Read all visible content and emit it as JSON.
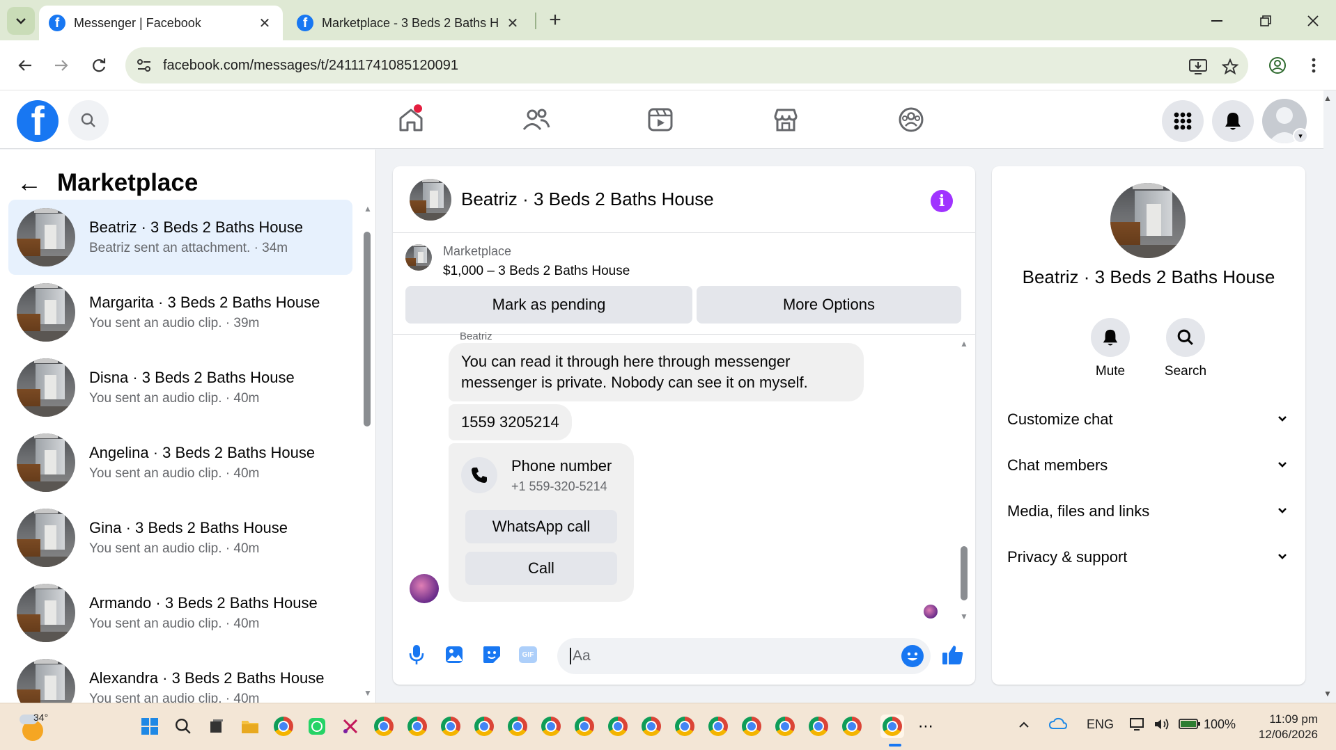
{
  "browser": {
    "tabs": [
      {
        "title": "Messenger | Facebook",
        "active": true
      },
      {
        "title": "Marketplace - 3 Beds 2 Baths H",
        "active": false
      }
    ],
    "url": "facebook.com/messages/t/24111741085120091"
  },
  "left": {
    "title": "Marketplace",
    "conversations": [
      {
        "name": "Beatriz · 3 Beds 2 Baths House",
        "sub": "Beatriz sent an attachment. · 34m"
      },
      {
        "name": "Margarita · 3 Beds 2 Baths House",
        "sub": "You sent an audio clip. · 39m"
      },
      {
        "name": "Disna · 3 Beds 2 Baths House",
        "sub": "You sent an audio clip. · 40m"
      },
      {
        "name": "Angelina · 3 Beds 2 Baths House",
        "sub": "You sent an audio clip. · 40m"
      },
      {
        "name": "Gina · 3 Beds 2 Baths House",
        "sub": "You sent an audio clip. · 40m"
      },
      {
        "name": "Armando · 3 Beds 2 Baths House",
        "sub": "You sent an audio clip. · 40m"
      },
      {
        "name": "Alexandra · 3 Beds 2 Baths House",
        "sub": "You sent an audio clip. · 40m"
      }
    ]
  },
  "chat": {
    "title": "Beatriz · 3 Beds 2 Baths House",
    "listing_kind": "Marketplace",
    "listing_price": "$1,000 – 3 Beds 2 Baths House",
    "btn_pending": "Mark as pending",
    "btn_more": "More Options",
    "sender": "Beatriz",
    "msg1": "You can read it through here through messenger messenger is private. Nobody can see it on myself.",
    "msg2": "1559 3205214",
    "contact_title": "Phone number",
    "contact_number": "+1 559-320-5214",
    "whatsapp_call": "WhatsApp call",
    "call": "Call",
    "input_placeholder": "Aa",
    "gif_label": "GIF"
  },
  "info": {
    "name": "Beatriz · 3 Beds 2 Baths House",
    "mute": "Mute",
    "search": "Search",
    "sections": [
      "Customize chat",
      "Chat members",
      "Media, files and links",
      "Privacy & support"
    ]
  },
  "taskbar": {
    "temperature": "34°",
    "lang": "ENG",
    "battery": "100%",
    "time": "11:09 pm",
    "date": "12/06/2026"
  }
}
